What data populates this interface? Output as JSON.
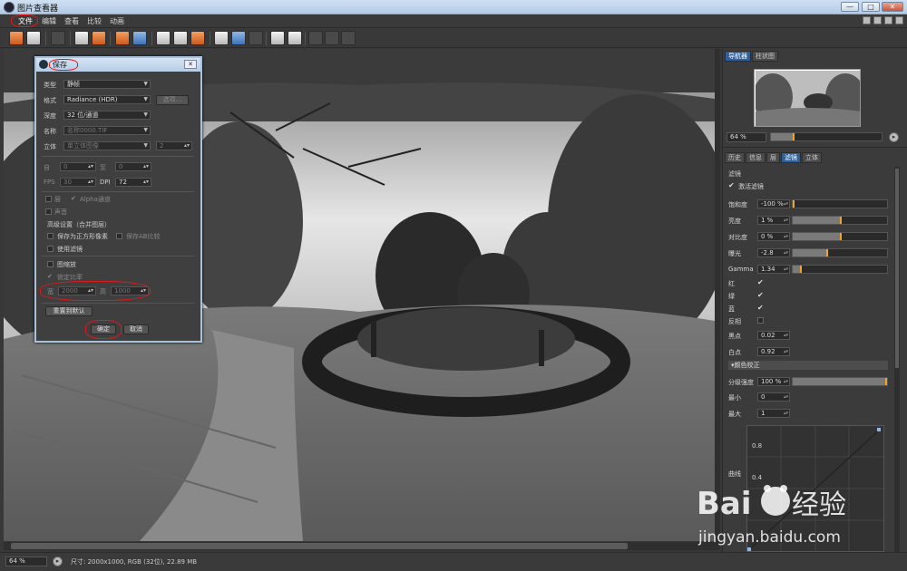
{
  "window": {
    "title": "图片查看器",
    "min": "—",
    "max": "□",
    "close": "✕"
  },
  "menu": {
    "items": [
      "文件",
      "编辑",
      "查看",
      "比较",
      "动画"
    ]
  },
  "statusbar": {
    "zoom": "64 %",
    "info": "尺寸: 2000x1000, RGB (32位), 22.89 MB"
  },
  "panel": {
    "top_tabs": [
      "导航器",
      "柱状图"
    ],
    "nav_zoom": "64 %",
    "bottom_tabs": [
      "历史",
      "信息",
      "层",
      "滤镜",
      "立体"
    ],
    "active_bottom_tab": "滤镜",
    "filter_header": "滤镜",
    "enable_filter": "激活滤镜",
    "rows": [
      {
        "label": "饱和度",
        "value": "-100 %",
        "level": 0.0
      },
      {
        "label": "亮度",
        "value": "1 %",
        "level": 0.5
      },
      {
        "label": "对比度",
        "value": "0 %",
        "level": 0.5
      },
      {
        "label": "曝光",
        "value": "-2.8",
        "level": 0.36
      },
      {
        "label": "Gamma",
        "value": "1.34",
        "level": 0.08
      }
    ],
    "channels": [
      "红",
      "绿",
      "蓝"
    ],
    "invert": "反相",
    "black_point": {
      "label": "黑点",
      "value": "0.02"
    },
    "white_point": {
      "label": "白点",
      "value": "0.92"
    },
    "color_correction": "▾颜色校正",
    "level_strength": {
      "label": "分级强度",
      "value": "100 %",
      "level": 1.0
    },
    "min": {
      "label": "最小",
      "value": "0"
    },
    "max": {
      "label": "最大",
      "value": "1"
    },
    "curve_label": "曲线",
    "curve_ticks": [
      "0.8",
      "0.4"
    ]
  },
  "dialog": {
    "title": "保存",
    "close": "✕",
    "type_label": "类型",
    "type_value": "静帧",
    "format_label": "格式",
    "format_value": "Radiance (HDR)",
    "options_button": "选项...",
    "depth_label": "深度",
    "depth_value": "32 位/通道",
    "name_label": "名称",
    "name_value": "名称0000.TIF",
    "stereo_label": "立体",
    "stereo_value": "单立体图像",
    "stereo_num": "2",
    "from_label": "自",
    "from_value": "0",
    "to_label": "至",
    "to_value": "0",
    "fps_label": "FPS",
    "fps_value": "30",
    "dpi_label": "DPI",
    "dpi_value": "72",
    "layer": "层",
    "alpha": "Alpha通道",
    "sound": "声音",
    "advanced": "高级设置（合并图层）",
    "save_square": "保存为正方形像素",
    "save_ab": "保存AB比较",
    "use_filter": "使用滤镜",
    "image_scale": "图缩放",
    "lock_ratio": "锁定比率",
    "width_label": "宽",
    "width_value": "2000",
    "height_label": "高",
    "height_value": "1000",
    "reset_button": "重置到默认",
    "ok_button": "确定",
    "cancel_button": "取消"
  },
  "watermark": {
    "text": "jingyan.baidu.com",
    "logo": "Bai 经验"
  }
}
